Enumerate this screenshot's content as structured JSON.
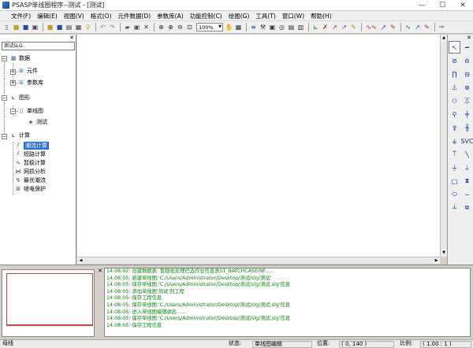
{
  "window": {
    "title": "PSASP单线图程序--测试 - [测试]",
    "controls": [
      "—",
      "☐",
      "✕"
    ]
  },
  "menu": [
    "文件(F)",
    "编辑(E)",
    "视图(V)",
    "格式(O)",
    "元件数据(D)",
    "参数库(A)",
    "功能控制(C)",
    "绘图(G)",
    "工具(T)",
    "窗口(W)",
    "帮助(H)"
  ],
  "toolbar": {
    "zoom": "100%"
  },
  "tree": {
    "header": "测试SLG",
    "nodes": [
      {
        "label": "数据",
        "icon": "database-icon"
      },
      {
        "label": "元件",
        "icon": "component-icon"
      },
      {
        "label": "参数库",
        "icon": "library-icon"
      },
      {
        "label": "图形",
        "icon": "graphics-icon"
      },
      {
        "label": "单线图",
        "icon": "diagram-icon"
      },
      {
        "label": "测试",
        "icon": "sheet-icon"
      },
      {
        "label": "计算",
        "icon": "calc-icon"
      },
      {
        "label": "潮流计算",
        "icon": "powerflow-icon"
      },
      {
        "label": "短路计算",
        "icon": "shortcircuit-icon"
      },
      {
        "label": "暂稳计算",
        "icon": "transient-icon"
      },
      {
        "label": "网损分析",
        "icon": "loss-icon"
      },
      {
        "label": "最优潮流",
        "icon": "opf-icon"
      },
      {
        "label": "继电保护",
        "icon": "relay-icon"
      }
    ]
  },
  "palette": {
    "svc_label": "SVC"
  },
  "log": [
    "14:08:02: 创建数据表: 暂稳批处理已选作业信息表ST_BATCHCASEINF......",
    "14:08:05: 新建单线图:'C:/Users/Administrator/Desktop/测试/slg/测试'",
    "14:08:05: 保存单线图:'C:/Users/Administrator/Desktop/测试/slg/测试.slg'信息",
    "14:08:05: 添加单线图'测试'到工程",
    "14:08:05: 保存工程信息",
    "14:08:05: 保存单线图:'C:/Users/Administrator/Desktop/测试/slg/测试.slg'信息",
    "14:08:05: 进入单线图编辑状态......",
    "14:08:05: 保存单线图:'C:/Users/Administrator/Desktop/测试/slg/测试.slg'信息",
    "14:08:05: 保存工程信息"
  ],
  "status": {
    "mode": "母线",
    "state_label": "状态:",
    "state_value": "单线图编辑",
    "pos_label": "位置:",
    "pos_value": "( 0, 140 )",
    "scale_label": "比例:",
    "scale_value": "( 1.00 : 1 )"
  }
}
